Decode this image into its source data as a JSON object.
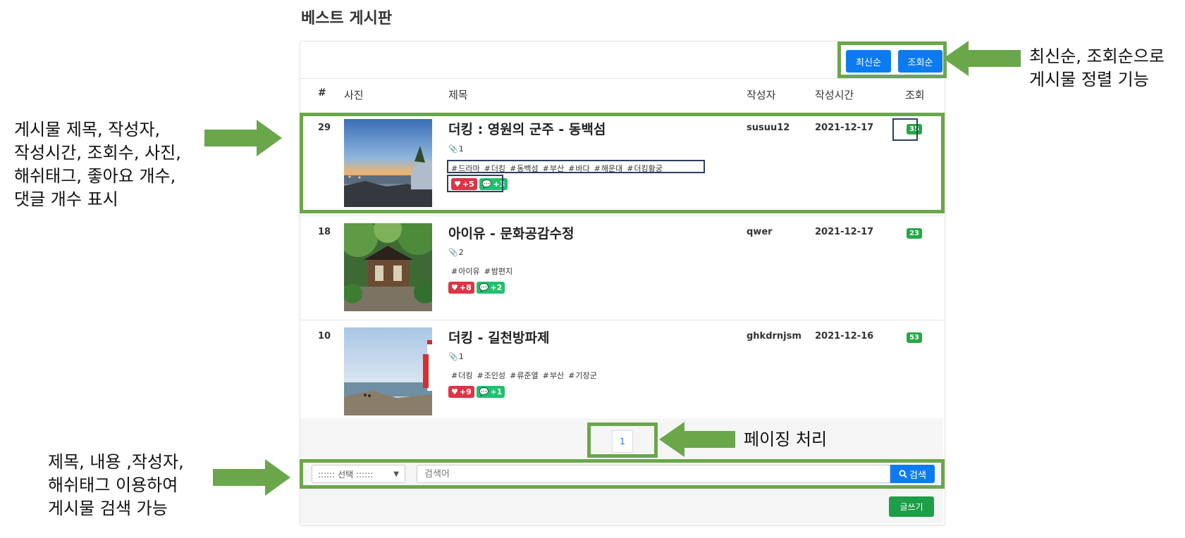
{
  "page_title": "베스트 게시판",
  "sort_buttons": {
    "latest": "최신순",
    "views": "조회순"
  },
  "table_headers": {
    "num": "#",
    "photo": "사진",
    "title": "제목",
    "author": "작성자",
    "date": "작성시간",
    "views": "조회"
  },
  "posts": [
    {
      "num": "29",
      "title": "더킹 : 영원의 군주 - 동백섬",
      "attachments": "1",
      "tags": [
        "드라마",
        "더킹",
        "동백섬",
        "부산",
        "바다",
        "해운대",
        "더킹황궁"
      ],
      "likes": "+5",
      "comments": "+3",
      "author": "susuu12",
      "date": "2021-12-17",
      "views": "35"
    },
    {
      "num": "18",
      "title": "아이유 - 문화공감수정",
      "attachments": "2",
      "tags": [
        "아이유",
        "밤편지"
      ],
      "likes": "+8",
      "comments": "+2",
      "author": "qwer",
      "date": "2021-12-17",
      "views": "23"
    },
    {
      "num": "10",
      "title": "더킹 - 길천방파제",
      "attachments": "1",
      "tags": [
        "더킹",
        "조인성",
        "류준열",
        "부산",
        "기장군"
      ],
      "likes": "+9",
      "comments": "+1",
      "author": "ghkdrnjsm",
      "date": "2021-12-16",
      "views": "53"
    }
  ],
  "pagination": {
    "current": "1"
  },
  "search": {
    "select_value": ":::::: 선택 ::::::",
    "placeholder": "검색어",
    "button": "검색"
  },
  "write_button": "글쓰기",
  "annotations": {
    "sort_line1": "최신순, 조회순으로",
    "sort_line2": "게시물 정렬 기능",
    "list_line1": "게시물 제목, 작성자,",
    "list_line2": "작성시간, 조회수, 사진,",
    "list_line3": "해쉬태그, 좋아요 개수,",
    "list_line4": "댓글 개수 표시",
    "paging": "페이징 처리",
    "search_line1": "제목, 내용 ,작성자,",
    "search_line2": "해쉬태그 이용하여",
    "search_line3": "게시물 검색 가능"
  },
  "colors": {
    "primary": "#0d7bf0",
    "success": "#28a745",
    "danger": "#dc3545",
    "annotation_green": "#6aa74a",
    "highlight_navy": "#2e3f5c"
  }
}
